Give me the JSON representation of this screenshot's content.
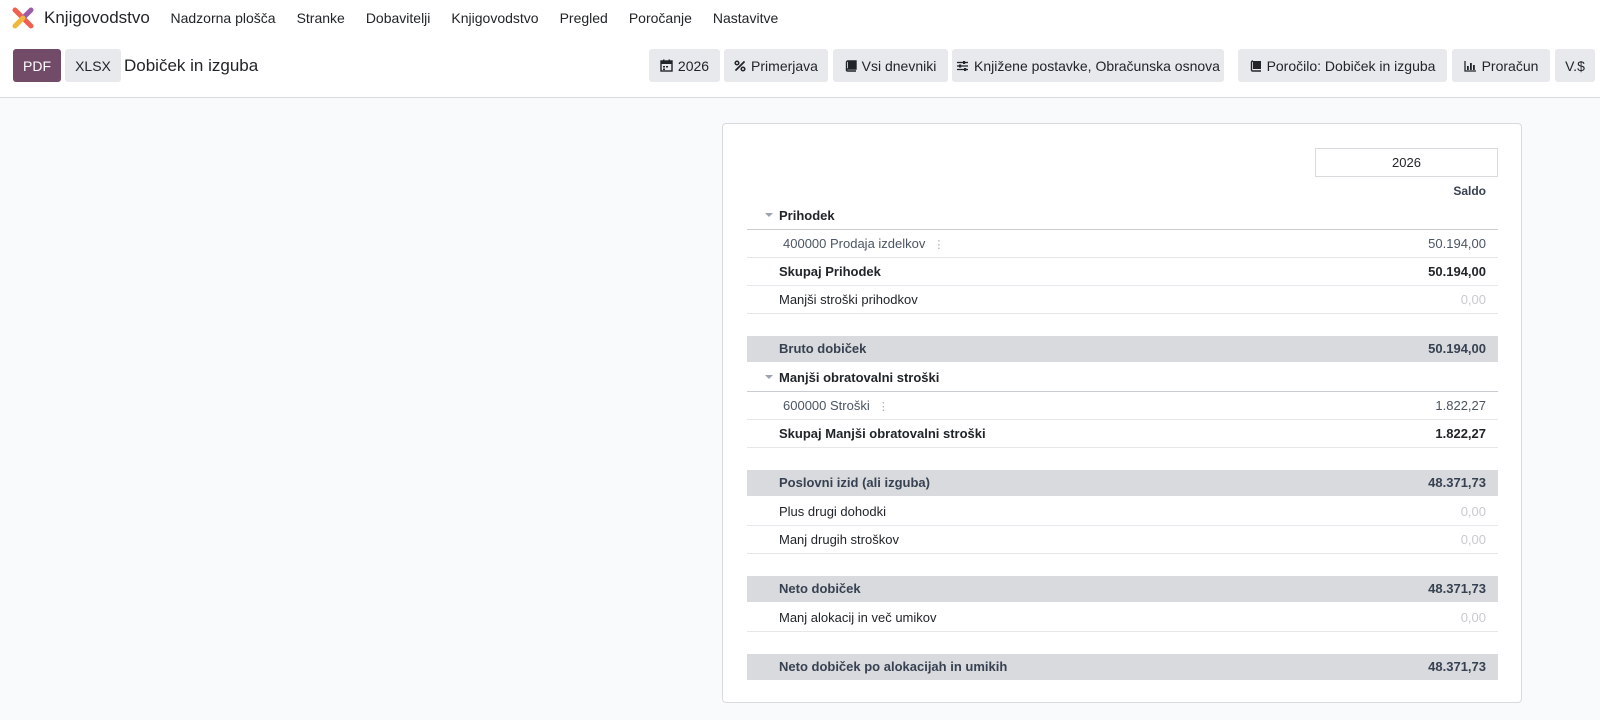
{
  "app": {
    "name": "Knjigovodstvo",
    "menu": [
      "Nadzorna plošča",
      "Stranke",
      "Dobavitelji",
      "Knjigovodstvo",
      "Pregled",
      "Poročanje",
      "Nastavitve"
    ]
  },
  "toolbar": {
    "pdf_label": "PDF",
    "xlsx_label": "XLSX",
    "title": "Dobiček in izguba",
    "filters": {
      "period": "2026",
      "comparison": "Primerjava",
      "journals": "Vsi dnevniki",
      "options": "Knjižene postavke, Obračunska osnova",
      "report": "Poročilo: Dobiček in izguba",
      "budget": "Proračun",
      "currency": "V.$"
    }
  },
  "report": {
    "column_header": "2026",
    "column_subheader": "Saldo",
    "rows": {
      "income_header": {
        "label": "Prihodek"
      },
      "income_account": {
        "label": "400000 Prodaja izdelkov",
        "value": "50.194,00"
      },
      "income_total": {
        "label": "Skupaj Prihodek",
        "value": "50.194,00"
      },
      "cost_of_revenue": {
        "label": "Manjši stroški prihodkov",
        "value": "0,00"
      },
      "gross_profit": {
        "label": "Bruto dobiček",
        "value": "50.194,00"
      },
      "opex_header": {
        "label": "Manjši obratovalni stroški"
      },
      "opex_account": {
        "label": "600000 Stroški",
        "value": "1.822,27"
      },
      "opex_total": {
        "label": "Skupaj Manjši obratovalni stroški",
        "value": "1.822,27"
      },
      "operating_income": {
        "label": "Poslovni izid (ali izguba)",
        "value": "48.371,73"
      },
      "other_income": {
        "label": "Plus drugi dohodki",
        "value": "0,00"
      },
      "other_expenses": {
        "label": "Manj drugih stroškov",
        "value": "0,00"
      },
      "net_profit": {
        "label": "Neto dobiček",
        "value": "48.371,73"
      },
      "allocations": {
        "label": "Manj alokacij in več umikov",
        "value": "0,00"
      },
      "net_after_alloc": {
        "label": "Neto dobiček po alokacijah in umikih",
        "value": "48.371,73"
      }
    }
  }
}
